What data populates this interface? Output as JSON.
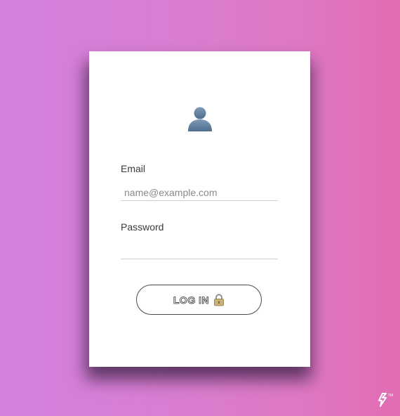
{
  "login_form": {
    "email_label": "Email",
    "email_placeholder": "name@example.com",
    "email_value": "",
    "password_label": "Password",
    "password_value": "",
    "login_button_label": "LOG IN",
    "avatar_icon": "user-silhouette-icon",
    "lock_icon": "padlock-icon"
  },
  "branding": {
    "logo_icon": "brand-logo-icon"
  },
  "colors": {
    "gradient_left": "#d380de",
    "gradient_right": "#e26cb2",
    "card_background": "#ffffff",
    "avatar_color": "#5b7b9a",
    "lock_color": "#b8a06a"
  }
}
